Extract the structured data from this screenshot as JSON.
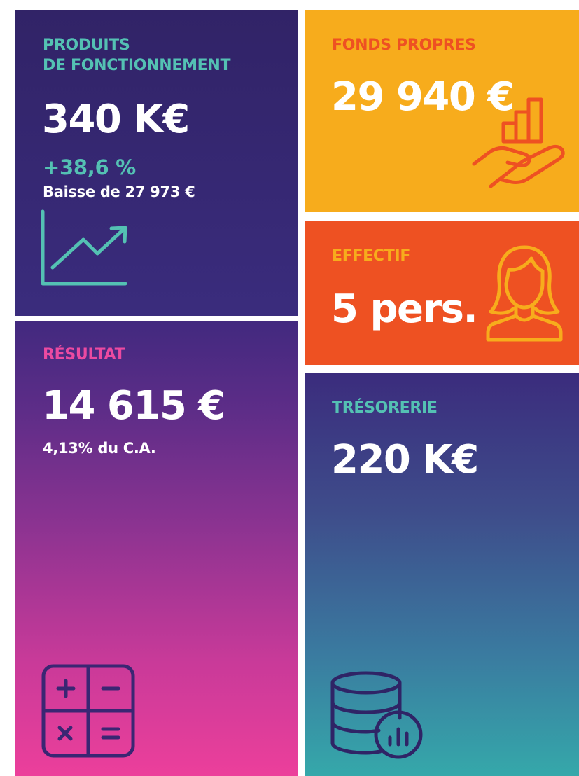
{
  "colors": {
    "teal": "#54c1b3",
    "pink": "#ec4aa1",
    "orange_red": "#ee5122",
    "amber": "#f7ac1c",
    "navy": "#312367",
    "white": "#ffffff"
  },
  "produits": {
    "label_line1": "PRODUITS",
    "label_line2": "DE FONCTIONNEMENT",
    "value": "340 K€",
    "change": "+38,6 %",
    "change_note": "Baisse de 27 973 €",
    "icon": "line-chart-icon"
  },
  "resultat": {
    "label": "RÉSULTAT",
    "value": "14 615 €",
    "note": "4,13% du C.A.",
    "icon": "calculator-icon"
  },
  "fonds": {
    "label": "FONDS PROPRES",
    "value": "29 940 €",
    "icon": "hand-growth-icon"
  },
  "effectif": {
    "label": "EFFECTIF",
    "value": "5 pers.",
    "icon": "woman-avatar-icon"
  },
  "tresorerie": {
    "label": "TRÉSORERIE",
    "value": "220 K€",
    "icon": "database-chart-icon"
  }
}
